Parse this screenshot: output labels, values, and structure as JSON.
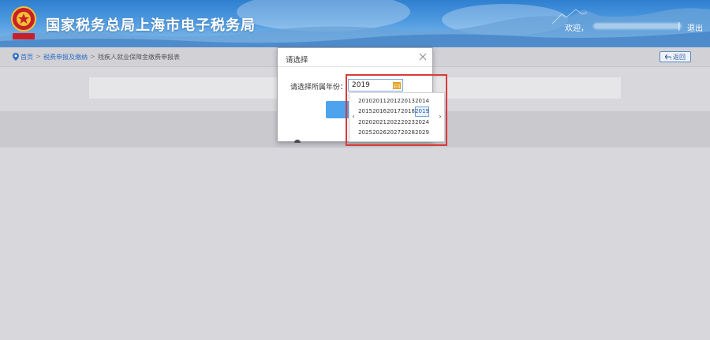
{
  "header": {
    "title": "国家税务总局上海市电子税务局",
    "welcome": "欢迎，",
    "divider": "|",
    "logout": "退出",
    "emblem_text": "中国税务"
  },
  "breadcrumb": {
    "home": "首页",
    "separator": ">",
    "level2": "税费申报及缴纳",
    "level3": "残疾人就业保障金缴费申报表",
    "back_label": "返回"
  },
  "dialog": {
    "title": "请选择",
    "year_label": "请选择所属年份：",
    "year_value": "2019"
  },
  "year_picker": {
    "prev": "‹",
    "next": "›",
    "years": [
      "2010",
      "2011",
      "2012",
      "2013",
      "2014",
      "2015",
      "2016",
      "2017",
      "2018",
      "2019",
      "2020",
      "2021",
      "2022",
      "2023",
      "2024",
      "2025",
      "2026",
      "2027",
      "2028",
      "2029"
    ],
    "selected": "2019"
  },
  "colors": {
    "header_blue": "#2f7fd0",
    "link_blue": "#2f6fc4",
    "button_blue": "#4da3ee",
    "highlight_red": "#d93a3a"
  }
}
